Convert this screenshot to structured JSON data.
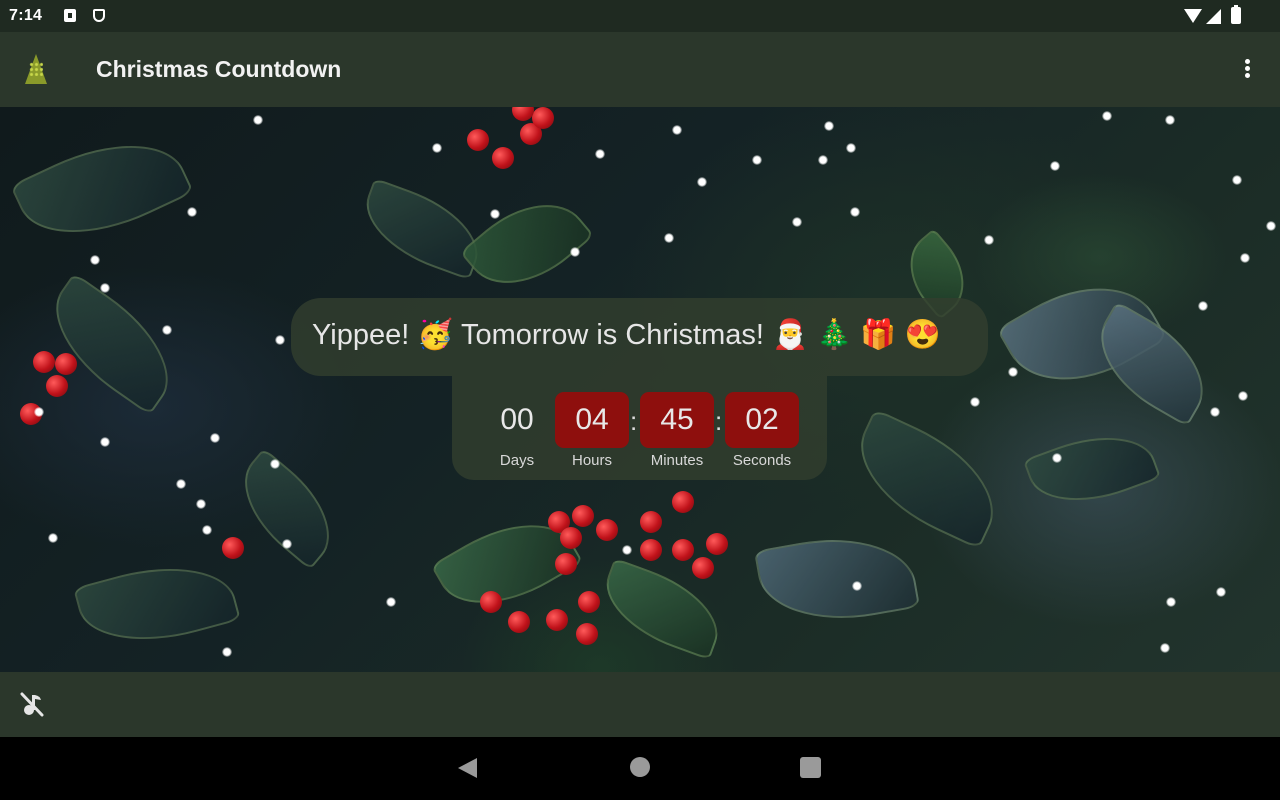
{
  "status_bar": {
    "time": "7:14",
    "left_icons": [
      "notification-a-icon",
      "shield-icon"
    ],
    "right_icons": [
      "wifi-icon",
      "signal-icon",
      "battery-icon"
    ]
  },
  "app_bar": {
    "logo_icon": "christmas-tree-icon",
    "title": "Christmas Countdown",
    "menu_icon": "overflow-menu-icon"
  },
  "message": {
    "text": "Yippee! 🥳 Tomorrow is Christmas! 🎅 🎄 🎁 😍"
  },
  "countdown": {
    "units": [
      {
        "value": "00",
        "label": "Days",
        "highlighted": false
      },
      {
        "value": "04",
        "label": "Hours",
        "highlighted": true
      },
      {
        "value": "45",
        "label": "Minutes",
        "highlighted": true
      },
      {
        "value": "02",
        "label": "Seconds",
        "highlighted": true
      }
    ],
    "separator": ":",
    "highlight_color": "#8e0f0d"
  },
  "bottom_bar": {
    "music_toggle_icon": "music-off-icon"
  },
  "nav_bar": {
    "buttons": [
      "back-icon",
      "home-icon",
      "recent-apps-icon"
    ]
  },
  "colors": {
    "app_bar": "#2b372b",
    "status_bar": "#1f2a21",
    "overlay": "#323e2e"
  }
}
